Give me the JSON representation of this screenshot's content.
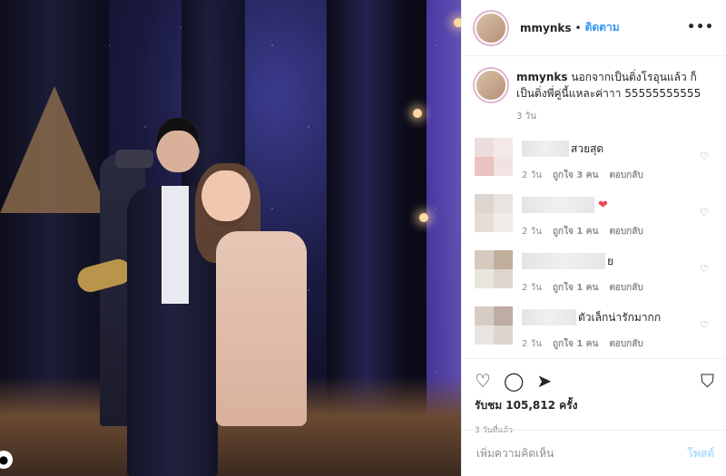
{
  "header": {
    "username": "mmynks",
    "separator": "•",
    "follow_label": "ติดตาม",
    "more_label": "•••"
  },
  "caption": {
    "username": "mmynks",
    "text": "นอกจากเป็นติ่งโรอุนแล้ว ก็เป็นติ่งพี่คู่นี้แหละค่าาา 55555555555",
    "time": "3 วัน"
  },
  "comments": [
    {
      "text": "สวยสุด",
      "time": "2 วัน",
      "likes": "ถูกใจ 3 คน",
      "reply": "ตอบกลับ",
      "avatar_colors": [
        "#e9d6d6",
        "#f1e6e6",
        "#e6b8b8",
        "#f0dede"
      ]
    },
    {
      "text": "",
      "emoji": "❤",
      "time": "2 วัน",
      "likes": "ถูกใจ 1 คน",
      "reply": "ตอบกลับ",
      "avatar_colors": [
        "#d8d0c8",
        "#e6e0da",
        "#e2d8cf",
        "#efe9e4"
      ]
    },
    {
      "text": "ย",
      "time": "2 วัน",
      "likes": "ถูกใจ 1 คน",
      "reply": "ตอบกลับ",
      "avatar_colors": [
        "#cfc1b4",
        "#b8a18d",
        "#e8e1db",
        "#d9cfc6"
      ]
    },
    {
      "text": "ตัวเล็กน่ารักมากก",
      "time": "2 วัน",
      "likes": "ถูกใจ 1 คน",
      "reply": "ตอบกลับ",
      "avatar_colors": [
        "#cfc4bd",
        "#b39f95",
        "#e7e0db",
        "#d6ccc6"
      ]
    }
  ],
  "icons": {
    "like": "heart-outline-icon",
    "comment": "comment-icon",
    "share": "share-icon",
    "save": "bookmark-icon",
    "comment_like": "heart-outline-icon",
    "media_badge": "user-tag-icon"
  },
  "stats": {
    "views": "รับชม 105,812 ครั้ง",
    "post_time": "3 วันที่แล้ว"
  },
  "add_comment": {
    "placeholder": "เพิ่มความคิดเห็น",
    "post_label": "โพสต์"
  },
  "colors": {
    "accent": "#3897f0",
    "muted": "#8e8e8e",
    "heart": "#ed4956"
  }
}
